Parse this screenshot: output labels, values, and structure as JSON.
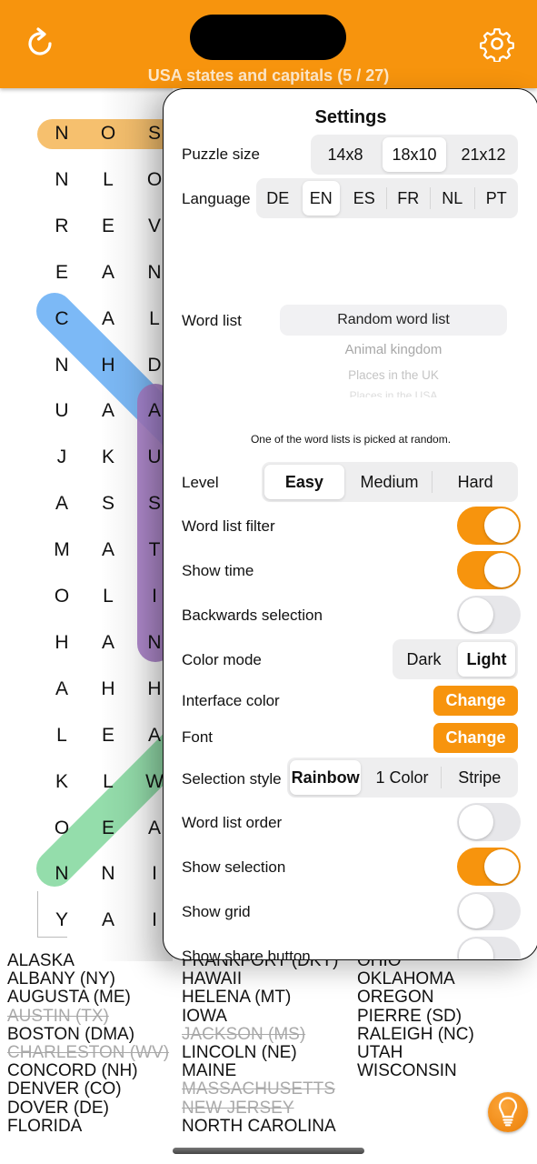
{
  "header": {
    "title": "USA states and capitals (5 / 27)",
    "refresh_icon": "refresh-icon",
    "settings_icon": "gear-icon",
    "accent_color": "#f7940d"
  },
  "grid": {
    "columns_visible": [
      [
        "N",
        "N",
        "R",
        "E",
        "C",
        "N",
        "U",
        "J",
        "A",
        "M",
        "O",
        "H",
        "A",
        "L",
        "K",
        "O",
        "N",
        "Y"
      ],
      [
        "O",
        "L",
        "E",
        "A",
        "A",
        "H",
        "A",
        "K",
        "S",
        "A",
        "L",
        "A",
        "H",
        "E",
        "L",
        "E",
        "N",
        "A"
      ],
      [
        "S",
        "O",
        "V",
        "N",
        "L",
        "D",
        "A",
        "U",
        "S",
        "T",
        "I",
        "N",
        "H",
        "A",
        "W",
        "A",
        "I",
        "I"
      ]
    ],
    "highlights": [
      {
        "word": "row 1 (NOS...)",
        "color": "#f6c06e"
      },
      {
        "word": "diagonal from C",
        "color": "#6eb1f5"
      },
      {
        "word": "AUSTIN (vertical)",
        "color": "#a77dc8"
      },
      {
        "word": "diagonal from N",
        "color": "#8edba6"
      }
    ]
  },
  "settings": {
    "title": "Settings",
    "puzzle_size": {
      "label": "Puzzle size",
      "options": [
        "14x8",
        "18x10",
        "21x12"
      ],
      "selected": "18x10"
    },
    "language": {
      "label": "Language",
      "options": [
        "DE",
        "EN",
        "ES",
        "FR",
        "NL",
        "PT"
      ],
      "selected": "EN"
    },
    "word_list": {
      "label": "Word list",
      "options": [
        "Random word list",
        "Animal kingdom",
        "Places in the UK",
        "Places in the USA"
      ],
      "selected": "Random word list",
      "note": "One of the word lists is picked at random."
    },
    "level": {
      "label": "Level",
      "options": [
        "Easy",
        "Medium",
        "Hard"
      ],
      "selected": "Easy"
    },
    "word_list_filter": {
      "label": "Word list filter",
      "on": true
    },
    "show_time": {
      "label": "Show time",
      "on": true
    },
    "backwards_selection": {
      "label": "Backwards selection",
      "on": false
    },
    "color_mode": {
      "label": "Color mode",
      "options": [
        "Dark",
        "Light"
      ],
      "selected": "Light"
    },
    "interface_color": {
      "label": "Interface color",
      "button": "Change"
    },
    "font": {
      "label": "Font",
      "button": "Change"
    },
    "selection_style": {
      "label": "Selection style",
      "options": [
        "Rainbow",
        "1 Color",
        "Stripe"
      ],
      "selected": "Rainbow"
    },
    "word_list_order": {
      "label": "Word list order",
      "on": false
    },
    "show_selection": {
      "label": "Show selection",
      "on": true
    },
    "show_grid": {
      "label": "Show grid",
      "on": false
    },
    "show_share_button": {
      "label": "Show share button",
      "on": false
    }
  },
  "word_list": {
    "col1": [
      {
        "text": "ALASKA",
        "found": false
      },
      {
        "text": "ALBANY (NY)",
        "found": false
      },
      {
        "text": "AUGUSTA (ME)",
        "found": false
      },
      {
        "text": "AUSTIN (TX)",
        "found": true
      },
      {
        "text": "BOSTON (DMA)",
        "found": false
      },
      {
        "text": "CHARLESTON (WV)",
        "found": true
      },
      {
        "text": "CONCORD (NH)",
        "found": false
      },
      {
        "text": "DENVER (CO)",
        "found": false
      },
      {
        "text": "DOVER (DE)",
        "found": false
      },
      {
        "text": "FLORIDA",
        "found": false
      }
    ],
    "col2": [
      {
        "text": "FRANKFORT (DKY)",
        "found": false
      },
      {
        "text": "HAWAII",
        "found": false
      },
      {
        "text": "HELENA (MT)",
        "found": false
      },
      {
        "text": "IOWA",
        "found": false
      },
      {
        "text": "JACKSON (MS)",
        "found": true
      },
      {
        "text": "LINCOLN (NE)",
        "found": false
      },
      {
        "text": "MAINE",
        "found": false
      },
      {
        "text": "MASSACHUSETTS",
        "found": true
      },
      {
        "text": "NEW JERSEY",
        "found": true
      },
      {
        "text": "NORTH CAROLINA",
        "found": false
      }
    ],
    "col3": [
      {
        "text": "OHIO",
        "found": false
      },
      {
        "text": "OKLAHOMA",
        "found": false
      },
      {
        "text": "OREGON",
        "found": false
      },
      {
        "text": "PIERRE (SD)",
        "found": false
      },
      {
        "text": "RALEIGH (NC)",
        "found": false
      },
      {
        "text": "UTAH",
        "found": false
      },
      {
        "text": "WISCONSIN",
        "found": false
      }
    ]
  },
  "hint_button": {
    "icon": "lightbulb-icon"
  }
}
